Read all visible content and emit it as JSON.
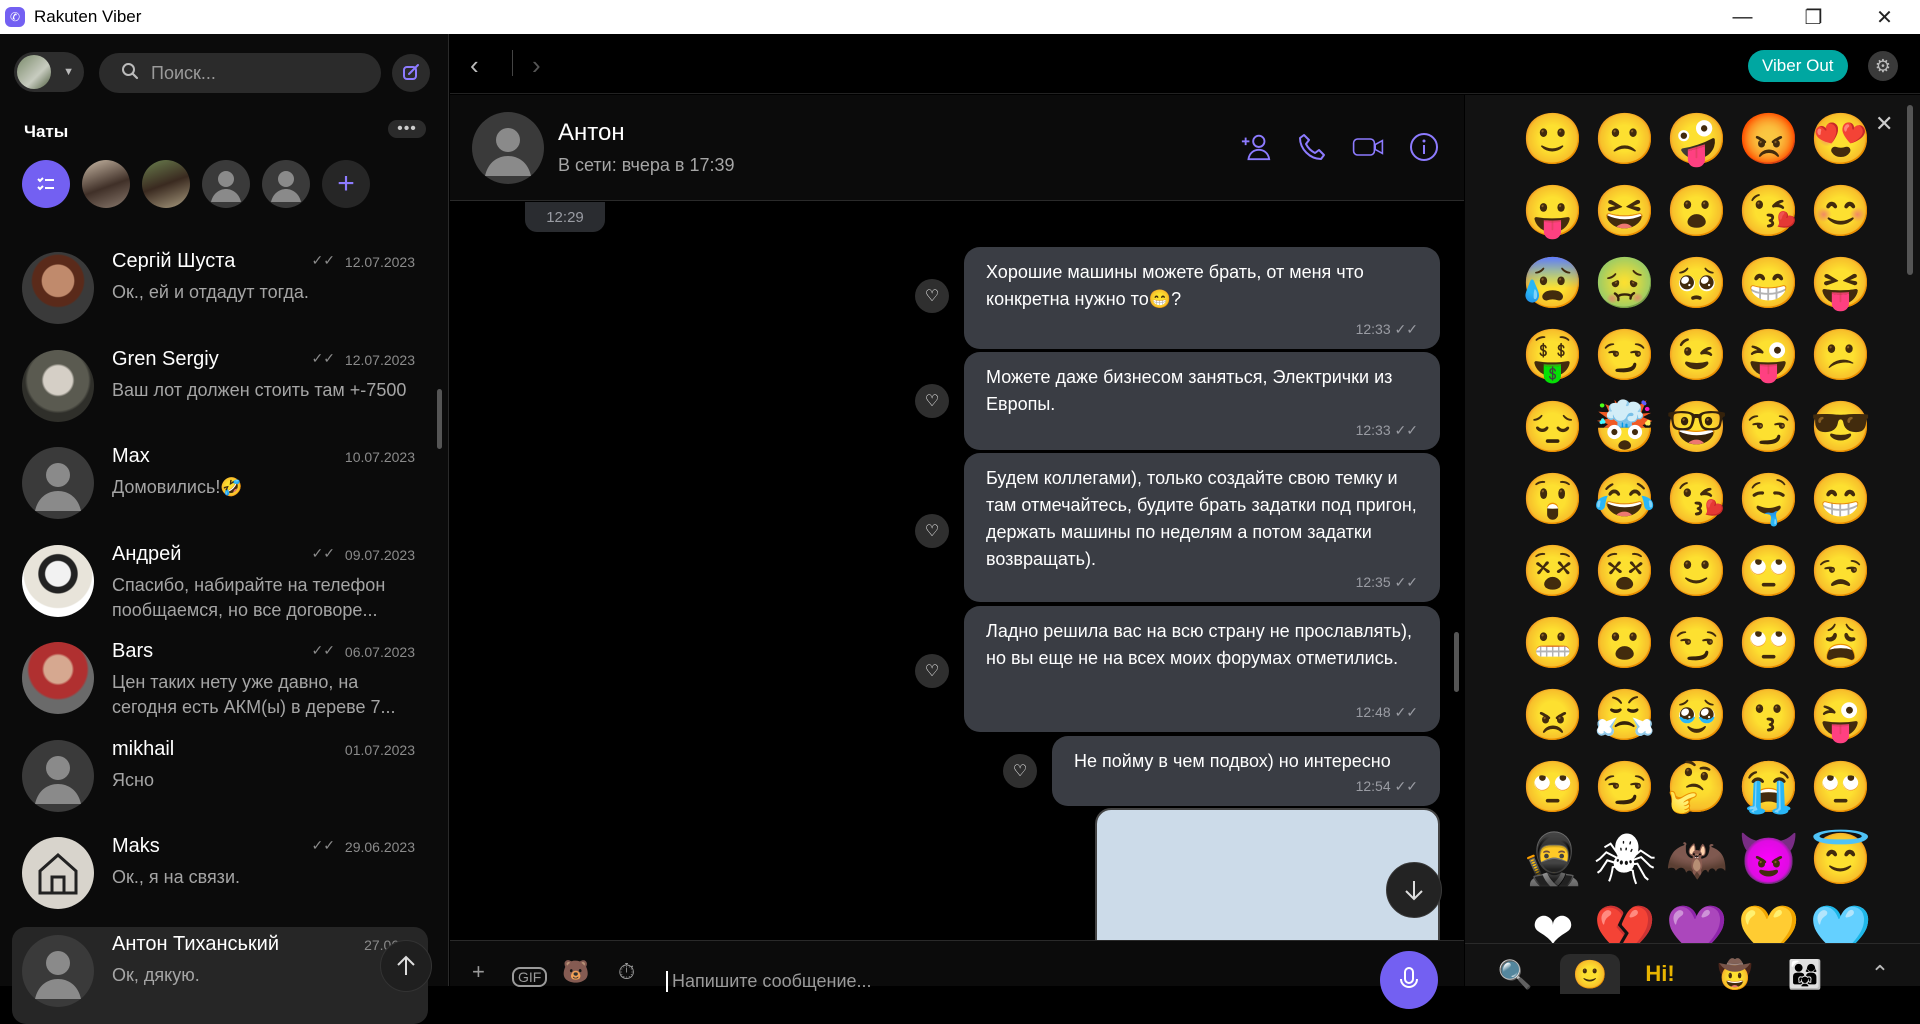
{
  "window": {
    "title": "Rakuten Viber"
  },
  "sidebar": {
    "search_placeholder": "Поиск...",
    "section_label": "Чаты",
    "more_label": "•••",
    "chats": [
      {
        "name": "Сергій Шуста",
        "preview": "Ок., ей и отдадут тогда.",
        "date": "12.07.2023",
        "read": true
      },
      {
        "name": "Gren Sergiy",
        "preview": "Ваш лот должен стоить там +-7500",
        "date": "12.07.2023",
        "read": true
      },
      {
        "name": "Max",
        "preview": "Домовились!🤣",
        "date": "10.07.2023",
        "read": false
      },
      {
        "name": "Андрей",
        "preview": "Спасибо, набирайте на телефон пообщаемся, но все договоре...",
        "date": "09.07.2023",
        "read": true
      },
      {
        "name": "Bars",
        "preview": "Цен таких нету уже давно, на сегодня есть АКМ(ы) в дереве 7...",
        "date": "06.07.2023",
        "read": true
      },
      {
        "name": "mikhail",
        "preview": "Ясно",
        "date": "01.07.2023",
        "read": false
      },
      {
        "name": "Maks",
        "preview": "Ок., я на связи.",
        "date": "29.06.2023",
        "read": true
      },
      {
        "name": "Антон Тиханський",
        "preview": "Ок, дякую.",
        "date": "27.06.",
        "read": false
      }
    ]
  },
  "topbar": {
    "viber_out_label": "Viber Out"
  },
  "chat": {
    "name": "Антон",
    "status": "В сети: вчера в 17:39",
    "earlier_time": "12:29",
    "messages": [
      {
        "text": "Хорошие машины можете брать, от меня что конкретна нужно то😁?",
        "time": "12:33"
      },
      {
        "text": "Можете даже бизнесом заняться, Электрички из Европы.",
        "time": "12:33"
      },
      {
        "text": "Будем коллегами), только создайте свою темку и там отмечайтесь, будите брать задатки под пригон, держать машины по неделям а потом задатки возвращать).",
        "time": "12:35"
      },
      {
        "text": "Ладно решила вас на всю страну не прославлять), но вы еще не на всех моих форумах отметились.",
        "time": "12:48"
      },
      {
        "text": "Не пойму в чем подвох) но интересно",
        "time": "12:54"
      }
    ],
    "composer_placeholder": "Напишите сообщение...",
    "gif_label": "GIF"
  },
  "emoji_panel": {
    "emojis": [
      "🙂",
      "🙁",
      "🤪",
      "😡",
      "😍",
      "😛",
      "😆",
      "😮",
      "😘",
      "😊",
      "😰",
      "🤢",
      "🥺",
      "😁",
      "😝",
      "🤑",
      "😏",
      "😉",
      "😜",
      "😕",
      "😔",
      "🤯",
      "🤓",
      "😏",
      "😎",
      "😲",
      "😂",
      "😘",
      "🤤",
      "😁",
      "😵",
      "😵",
      "🙂",
      "🙄",
      "😒",
      "😬",
      "😮",
      "😏",
      "🙄",
      "😩",
      "😠",
      "😤",
      "🥹",
      "😗",
      "😜",
      "🙄",
      "😏",
      "🤔",
      "😭",
      "🙄",
      "🥷",
      "🕷",
      "🦇",
      "😈",
      "😇",
      "❤",
      "💔",
      "💜",
      "💛",
      "🩵"
    ],
    "tabs": [
      "🔍",
      "🙂",
      "Hi!",
      "🤠",
      "👨‍👩‍👧",
      "⌃"
    ]
  },
  "colors": {
    "accent": "#7360f2",
    "viber_out": "#00a7a1",
    "bubble": "#3a3d44"
  }
}
